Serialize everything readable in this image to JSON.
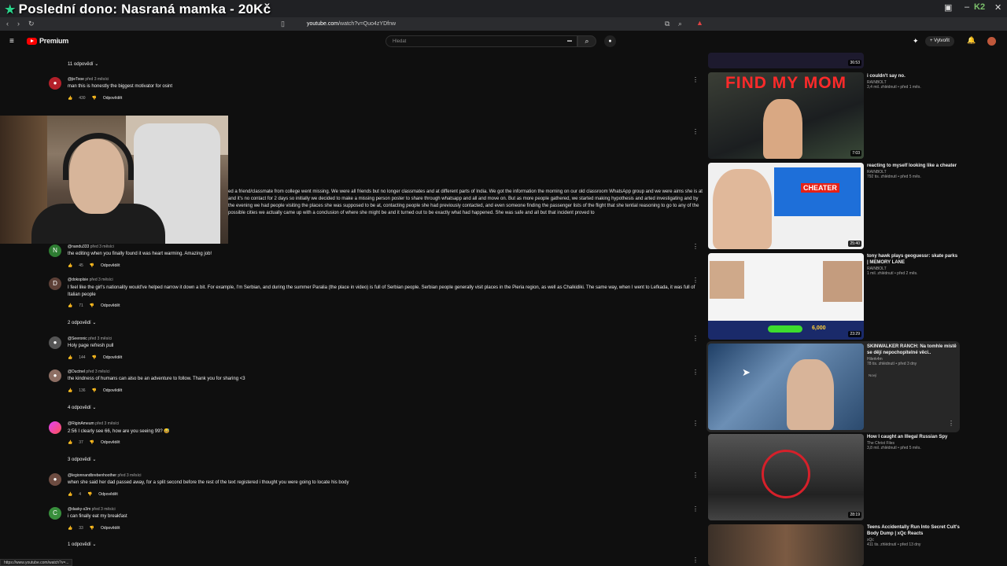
{
  "stream_title": "Poslední dono: Nasraná mamka - 20Kč",
  "browser": {
    "url_domain": "youtube.com",
    "url_path": "/watch?v=Quo4zYDfnw"
  },
  "header": {
    "logo_text": "Premium",
    "search_placeholder": "Hledat",
    "create_label": "Vytvořit"
  },
  "comments": [
    {
      "author": "@jieTooe",
      "time": "před 3 měsíci",
      "text": "man this is honestly the biggest motivator for osint",
      "likes": "430",
      "reply": "Odpovědět"
    },
    {
      "author": "",
      "time": "",
      "text": "ed a friend/classmate from college went missing. We were all friends but no longer classmates and at different parts of India. We got the information the morning on our old classroom WhatsApp group and we were aims she is at and it's no contact for 2 days so initially we decided to make a missing person poster to share through whatsapp and all and move on. But as more people gathered, we started making hypothesis and arted investigating and by the evening we had people visiting the places she was supposed to be at, contacting people she had previously contacted, and even someone finding the passenger lists of the flight that she tential reasoning to go to any of the possible cities we actually came up with a conclusion of where she might be and it turned out to be exactly what had happened. She was safe and all but that incident proved to",
      "likes": "",
      "reply": ""
    },
    {
      "author": "@nandu333",
      "time": "před 3 měsíci",
      "text": "the editing when you finally found it was heart warming. Amazing job!",
      "likes": "45",
      "reply": "Odpovědět"
    },
    {
      "author": "@dokoplsie",
      "time": "před 3 měsíci",
      "text": "I feel like the girl's nationality would've helped narrow it down a bit. For example, I'm Serbian, and during the summer Paralia (the place in video) is full of Serbian people. Serbian people generally visit places in the Pieria region, as well as Chalkidiki. The same way, when I went to Lefkada, it was full of Italian people",
      "likes": "71",
      "reply": "Odpovědět"
    },
    {
      "author": "@Seeronic",
      "time": "před 3 měsíci",
      "text": "Holy page refresh pull",
      "likes": "144",
      "reply": "Odpovědět"
    },
    {
      "author": "@Ductnel",
      "time": "před 3 měsíci",
      "text": "the kindness of humans can also be an adventure to follow.  Thank you for sharing <3",
      "likes": "136",
      "reply": "Odpovědět"
    },
    {
      "author": "@RiginAmeum",
      "time": "před 3 měsíci",
      "text": "2:56 I clearly see 66, how are you seeing 99? 😅",
      "likes": "37",
      "reply": "Odpovědět"
    },
    {
      "author": "@legionnandbrebenhoother",
      "time": "před 3 měsíci",
      "text": "when she said her dad passed away, for a split second before the rest of the text registered i thought you were going to locate his body",
      "likes": "4",
      "reply": "Odpovědět"
    },
    {
      "author": "@dasky-s3m",
      "time": "před 3 měsíci",
      "text": "i can finally eat my breakfast",
      "likes": "33",
      "reply": "Odpovědět"
    }
  ],
  "reply_toggles": [
    "11 odpovědí",
    "2 odpovědí",
    "4 odpovědí",
    "3 odpovědí",
    "1 odpovědí"
  ],
  "sidebar": [
    {
      "title": "i couldn't say no.",
      "channel": "RAINBOLT",
      "stats": "3,4 mil. zhlédnutí • před 1 měs.",
      "duration": "36:53",
      "thumb_text": "FIND MY MOM",
      "duration2": "7:03"
    },
    {
      "title": "reacting to myself looking like a cheater",
      "channel": "RAINBOLT",
      "stats": "792 tis. zhlédnutí • před 5 měs.",
      "duration": "25:40",
      "thumb_text": "CHEATER"
    },
    {
      "title": "tony hawk plays geoguessr: skate parks | MEMORY LANE",
      "channel": "RAINBOLT",
      "stats": "1 mil. zhlédnutí • před 2 měs.",
      "duration": "23:29",
      "thumb_text": "6,000"
    },
    {
      "title": "SKINWALKER RANCH: Na tomhle místě se dějí nepochopitelné věci..",
      "channel": "Hilerk4m",
      "stats": "78 tis. zhlédnutí • před 3 dny",
      "new": "Nový"
    },
    {
      "title": "How I caught an Illegal Russian Spy",
      "channel": "The Christ Files",
      "stats": "3,8 mil. zhlédnutí • před 5 měs.",
      "duration": "28:19"
    },
    {
      "title": "Teens Accidentally Run Into Secret Cult's Body Dump | xQc Reacts",
      "channel": "xQc",
      "stats": "411 tis. zhlédnutí • před 13 dny"
    }
  ],
  "status_url": "https://www.youtube.com/watch?v=..."
}
